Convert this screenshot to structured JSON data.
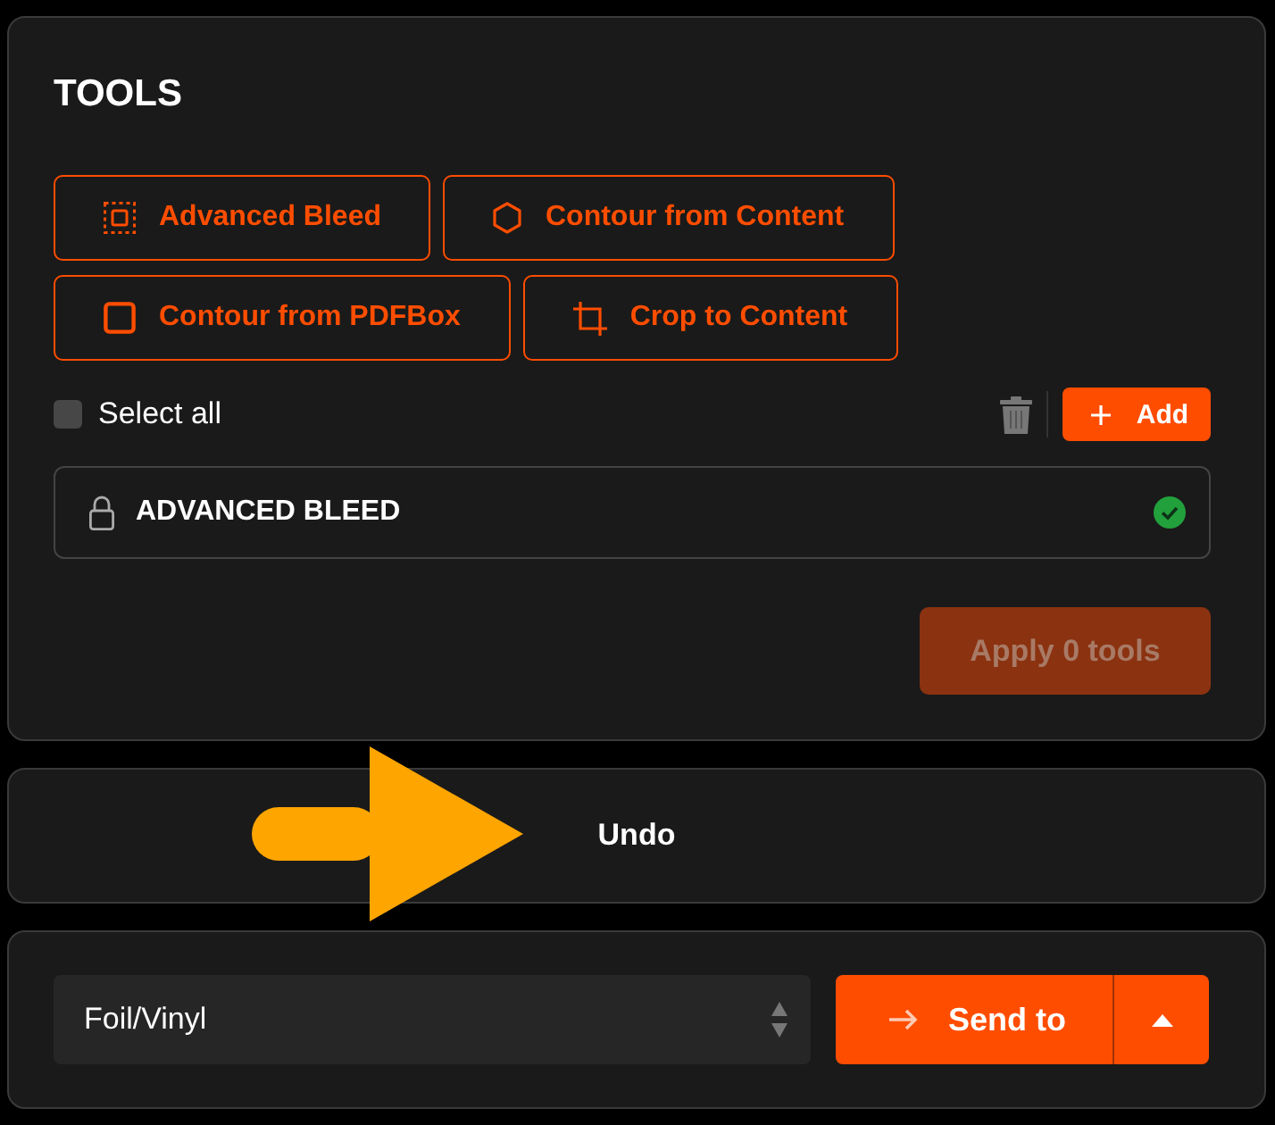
{
  "tools_panel": {
    "title": "TOOLS",
    "tool_buttons": [
      {
        "label": "Advanced Bleed"
      },
      {
        "label": "Contour from Content"
      },
      {
        "label": "Contour from PDFBox"
      },
      {
        "label": "Crop to Content"
      }
    ],
    "select_all": {
      "label": "Select all",
      "checked": false
    },
    "add_button": {
      "label": "Add"
    },
    "items": [
      {
        "label": "ADVANCED BLEED",
        "locked": true,
        "done": true
      }
    ],
    "apply_button": {
      "label": "Apply 0 tools",
      "disabled": true
    }
  },
  "undo_panel": {
    "label": "Undo"
  },
  "send_panel": {
    "material_select": {
      "value": "Foil/Vinyl"
    },
    "send_button": {
      "label": "Send to"
    }
  }
}
